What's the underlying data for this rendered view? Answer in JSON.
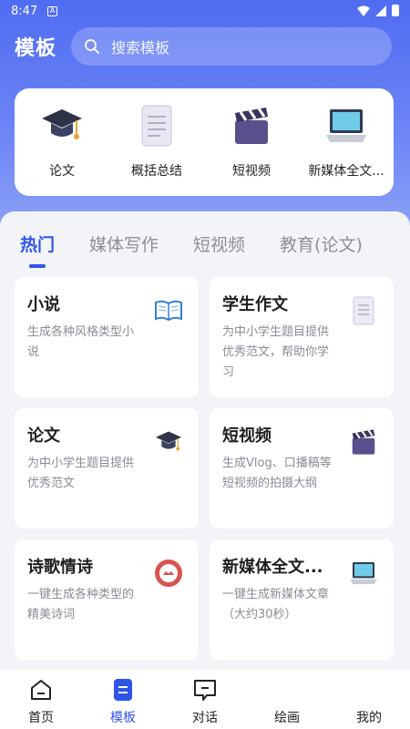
{
  "status": {
    "time": "8:47",
    "notif": "A"
  },
  "header": {
    "title": "模板",
    "search_placeholder": "搜索模板"
  },
  "quick": [
    {
      "label": "论文",
      "icon": "graduation-cap-icon"
    },
    {
      "label": "概括总结",
      "icon": "document-icon"
    },
    {
      "label": "短视频",
      "icon": "clapperboard-icon"
    },
    {
      "label": "新媒体全文...",
      "icon": "laptop-icon"
    }
  ],
  "tabs": [
    "热门",
    "媒体写作",
    "短视频",
    "教育(论文)"
  ],
  "cards": [
    {
      "title": "小说",
      "desc": "生成各种风格类型小说",
      "icon": "book-icon"
    },
    {
      "title": "学生作文",
      "desc": "为中小学生题目提供优秀范文，帮助你学习",
      "icon": "document-icon"
    },
    {
      "title": "论文",
      "desc": "为中小学生题目提供优秀范文",
      "icon": "graduation-cap-icon"
    },
    {
      "title": "短视频",
      "desc": "生成Vlog、口播稿等短视频的拍摄大纲",
      "icon": "clapperboard-icon"
    },
    {
      "title": "诗歌情诗",
      "desc": "一键生成各种类型的精美诗词",
      "icon": "poetry-badge-icon"
    },
    {
      "title": "新媒体全文...",
      "desc": "一键生成新媒体文章（大约30秒）",
      "icon": "laptop-icon"
    }
  ],
  "tabbar": [
    {
      "label": "首页",
      "icon": "home-icon"
    },
    {
      "label": "模板",
      "icon": "template-icon"
    },
    {
      "label": "对话",
      "icon": "chat-icon"
    },
    {
      "label": "绘画",
      "icon": "paint-icon"
    },
    {
      "label": "我的",
      "icon": "profile-icon"
    }
  ],
  "colors": {
    "accent": "#2f55e8",
    "hero_top": "#4f6cf2",
    "hero_bottom": "#8aa0f7",
    "background": "#f3f4f8"
  }
}
